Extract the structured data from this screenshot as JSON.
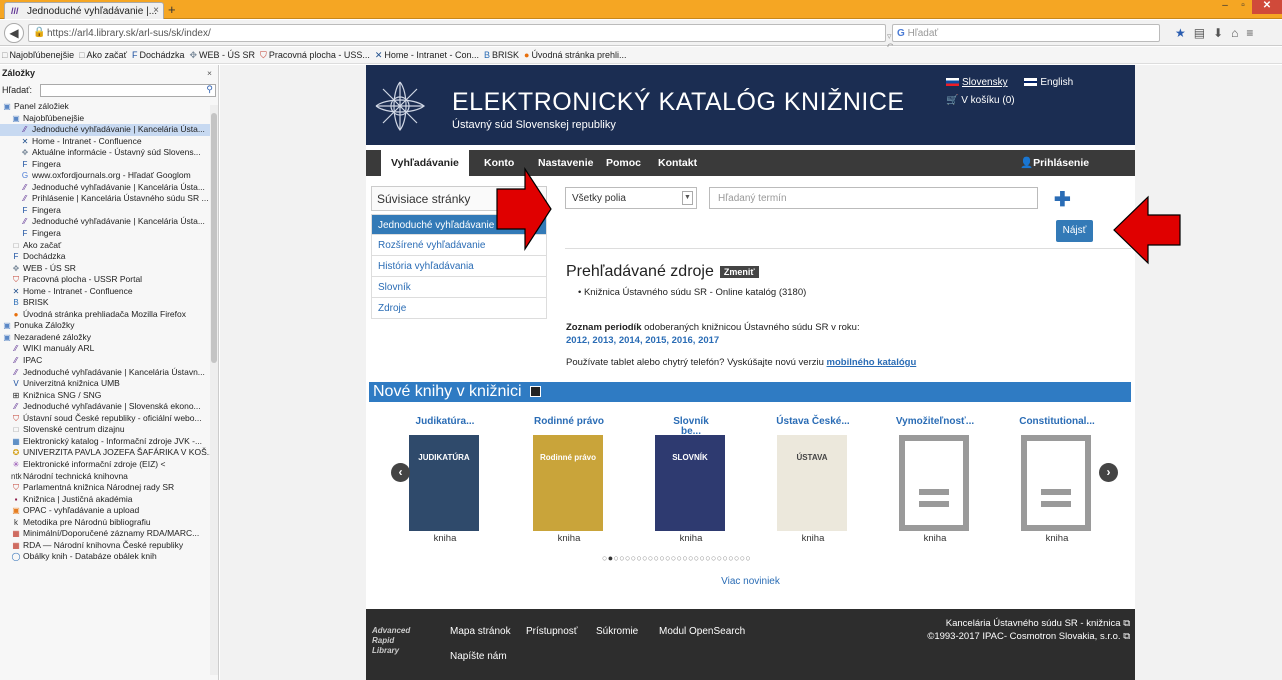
{
  "browser": {
    "tab_title": "Jednoduché vyhľadávanie |...",
    "tab_close": "×",
    "new_tab": "+",
    "url": "https://arl4.library.sk/arl-sus/sk/index/",
    "search_placeholder": "Hľadať",
    "window_controls": {
      "minimize": "–",
      "maximize": "▫",
      "close": "✕"
    }
  },
  "bookmarks_bar": [
    {
      "icon": "page-icon",
      "label": "Najobľúbenejšie"
    },
    {
      "icon": "page-icon",
      "label": "Ako začať"
    },
    {
      "icon": "fingera-icon",
      "label": "Dochádzka"
    },
    {
      "icon": "ussr-icon",
      "label": "WEB - ÚS SR"
    },
    {
      "icon": "portal-icon",
      "label": "Pracovná plocha - USS..."
    },
    {
      "icon": "confluence-icon",
      "label": "Home - Intranet - Con..."
    },
    {
      "icon": "brisk-icon",
      "label": "BRISK"
    },
    {
      "icon": "firefox-icon",
      "label": "Úvodná stránka prehli..."
    }
  ],
  "sidebar": {
    "title": "Záložky",
    "search_label": "Hľadať:",
    "items": [
      {
        "text": "Panel záložiek",
        "icon": "folder-icon",
        "indent": 0
      },
      {
        "text": "Najobľúbenejšie",
        "icon": "folder-icon",
        "indent": 1
      },
      {
        "text": "Jednoduché vyhľadávanie | Kancelária Ústa...",
        "icon": "arl-icon",
        "indent": 2,
        "selected": true
      },
      {
        "text": "Home - Intranet - Confluence",
        "icon": "confluence-icon",
        "indent": 2
      },
      {
        "text": "Aktuálne informácie - Ústavný súd Slovens...",
        "icon": "ussr-icon",
        "indent": 2
      },
      {
        "text": "Fingera",
        "icon": "fingera-icon",
        "indent": 2
      },
      {
        "text": "www.oxfordjournals.org - Hľadať Googlom",
        "icon": "google-icon",
        "indent": 2
      },
      {
        "text": "Jednoduché vyhľadávanie | Kancelária Ústa...",
        "icon": "arl-icon",
        "indent": 2
      },
      {
        "text": "Prihlásenie | Kancelária Ústavného súdu SR ...",
        "icon": "arl-icon",
        "indent": 2
      },
      {
        "text": "Fingera",
        "icon": "fingera-icon",
        "indent": 2
      },
      {
        "text": "Jednoduché vyhľadávanie | Kancelária Ústa...",
        "icon": "arl-icon",
        "indent": 2
      },
      {
        "text": "Fingera",
        "icon": "fingera-icon",
        "indent": 2
      },
      {
        "text": "Ako začať",
        "icon": "page-icon",
        "indent": 1
      },
      {
        "text": "Dochádzka",
        "icon": "fingera-icon",
        "indent": 1
      },
      {
        "text": "WEB - ÚS SR",
        "icon": "ussr-icon",
        "indent": 1
      },
      {
        "text": "Pracovná plocha - USSR Portal",
        "icon": "portal-icon",
        "indent": 1
      },
      {
        "text": "Home - Intranet - Confluence",
        "icon": "confluence-icon",
        "indent": 1
      },
      {
        "text": "BRISK",
        "icon": "brisk-icon",
        "indent": 1
      },
      {
        "text": "Úvodná stránka prehliadača Mozilla Firefox",
        "icon": "firefox-icon",
        "indent": 1
      },
      {
        "text": "Ponuka Záložky",
        "icon": "folder-icon",
        "indent": 0
      },
      {
        "text": "Nezaradené záložky",
        "icon": "folder-icon",
        "indent": 0
      },
      {
        "text": "WIKI manuály ARL",
        "icon": "arl-icon",
        "indent": 1
      },
      {
        "text": "IPAC",
        "icon": "arl-icon",
        "indent": 1
      },
      {
        "text": "Jednoduché vyhľadávanie | Kancelária Ústavn...",
        "icon": "arl-icon",
        "indent": 1
      },
      {
        "text": "Univerzitná knižnica UMB",
        "icon": "umb-icon",
        "indent": 1
      },
      {
        "text": "Knižnica SNG / SNG",
        "icon": "sng-icon",
        "indent": 1
      },
      {
        "text": "Jednoduché vyhľadávanie | Slovenská ekono...",
        "icon": "arl-icon",
        "indent": 1
      },
      {
        "text": "Ústavní soud České republiky - oficiální webo...",
        "icon": "cz-icon",
        "indent": 1
      },
      {
        "text": "Slovenské centrum dizajnu",
        "icon": "page-icon",
        "indent": 1
      },
      {
        "text": "Elektronický katalog - Informační zdroje JVK -...",
        "icon": "jvk-icon",
        "indent": 1
      },
      {
        "text": "UNIVERZITA PAVLA JOZEFA ŠAFÁRIKA V KOŠ...",
        "icon": "upjs-icon",
        "indent": 1
      },
      {
        "text": "Elektronické informační zdroje (EIZ) <",
        "icon": "eiz-icon",
        "indent": 1
      },
      {
        "text": "Národní technická knihovna",
        "icon": "ntk-icon",
        "indent": 1
      },
      {
        "text": "Parlamentná knižnica Národnej rady SR",
        "icon": "nrsr-icon",
        "indent": 1
      },
      {
        "text": "Knižnica | Justičná akadémia",
        "icon": "ja-icon",
        "indent": 1
      },
      {
        "text": "OPAC - vyhľadávanie a upload",
        "icon": "opac-icon",
        "indent": 1
      },
      {
        "text": "Metodika pre Národnú bibliografiu",
        "icon": "kb-icon",
        "indent": 1
      },
      {
        "text": "Minimální/Doporučené záznamy RDA/MARC...",
        "icon": "nkp-icon",
        "indent": 1
      },
      {
        "text": "RDA — Národní knihovna České republiky",
        "icon": "nkp-icon",
        "indent": 1
      },
      {
        "text": "Obálky knih - Databáze obálek knih",
        "icon": "obalky-icon",
        "indent": 1
      }
    ]
  },
  "site": {
    "title": "ELEKTRONICKÝ KATALÓG KNIŽNICE",
    "subtitle": "Ústavný súd Slovenskej republiky",
    "lang_sk": "Slovensky",
    "lang_en": "English",
    "cart": "V košíku (0)",
    "menu": [
      "Vyhľadávanie",
      "Konto",
      "Nastavenie",
      "Pomoc",
      "Kontakt"
    ],
    "login": "Prihlásenie"
  },
  "related": {
    "heading": "Súvisiace stránky",
    "items": [
      "Jednoduché vyhľadávanie",
      "Rozšírené vyhľadávanie",
      "História vyhľadávania",
      "Slovník",
      "Zdroje"
    ]
  },
  "search": {
    "field": "Všetky polia",
    "placeholder": "Hľadaný termín",
    "button": "Nájsť"
  },
  "sources": {
    "title": "Prehľadávané zdroje",
    "change": "Zmeniť",
    "item": "Knižnica Ústavného súdu SR - Online katalóg (3180)"
  },
  "periodicals": {
    "lead": "Zoznam periodík",
    "text": " odoberaných knižnicou Ústavného súdu SR v roku:",
    "years": "2012, 2013, 2014, 2015, 2016, 2017"
  },
  "tablet": {
    "text": "Používate tablet alebo chytrý telefón? Vyskúšajte novú verziu ",
    "link": "mobilného katalógu"
  },
  "new_books": {
    "title": "Nové knihy v knižnici",
    "books": [
      {
        "title": "Judikatúra...",
        "kind": "kniha",
        "cover": "#2f4a6b",
        "cover_text": "JUDIKATÚRA"
      },
      {
        "title": "Rodinné právo",
        "kind": "kniha",
        "cover": "#c9a43a",
        "cover_text": "Rodinné právo"
      },
      {
        "title": "Slovník",
        "title2": "be...",
        "kind": "kniha",
        "cover": "#2e3a70",
        "cover_text": "SLOVNÍK"
      },
      {
        "title": "Ústava České...",
        "kind": "kniha",
        "cover": "#ece8dc",
        "cover_text": "ÚSTAVA"
      },
      {
        "title": "Vymožiteľnosť...",
        "kind": "kniha",
        "cover": "#9a9a9a",
        "cover_text": ""
      },
      {
        "title": "Constitutional...",
        "kind": "kniha",
        "cover": "#9a9a9a",
        "cover_text": ""
      }
    ],
    "more": "Viac noviniek",
    "dots_total": 26,
    "dots_active": 2
  },
  "footer": {
    "logo": "Advanced Rapid Library",
    "links": [
      "Mapa stránok",
      "Prístupnosť",
      "Súkromie",
      "Modul OpenSearch"
    ],
    "write": "Napíšte nám",
    "right1": "Kancelária Ústavného súdu SR - knižnica",
    "right2": "©1993-2017 IPAC- Cosmotron Slovakia, s.r.o."
  },
  "colors": {
    "header_bg": "#1b2d52",
    "accent_blue": "#337ab7",
    "annotation_arrow": "#e00000"
  }
}
